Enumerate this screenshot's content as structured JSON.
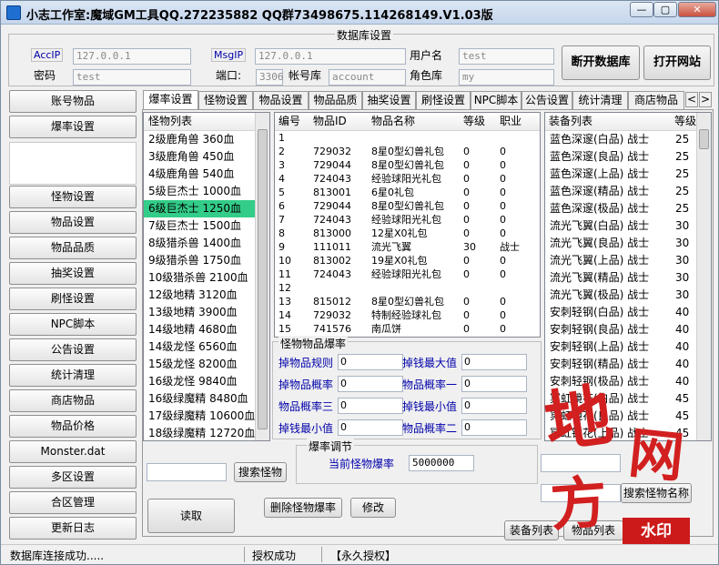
{
  "window": {
    "title": "小志工作室:魔域GM工具QQ.272235882 QQ群73498675.114268149.V1.03版",
    "minimize": "—",
    "maximize": "▢",
    "close": "✕"
  },
  "db": {
    "legend": "数据库设置",
    "acc_ip_label": "AccIP",
    "acc_ip_value": "127.0.0.1",
    "password_label": "密码",
    "password_value": "test",
    "msg_ip_label": "MsgIP",
    "msg_ip_value": "127.0.0.1",
    "port_label": "端口:",
    "port_value": "3306",
    "account_db_label": "帐号库",
    "account_db_value": "account",
    "user_label": "用户名",
    "user_value": "test",
    "role_db_label": "角色库",
    "role_db_value": "my",
    "disconnect_button": "断开数据库",
    "open_site_button": "打开网站"
  },
  "sidebar": {
    "items": [
      "账号物品",
      "爆率设置",
      "怪物设置",
      "物品设置",
      "物品品质",
      "抽奖设置",
      "刷怪设置",
      "NPC脚本",
      "公告设置",
      "统计清理",
      "商店物品",
      "物品价格",
      "Monster.dat",
      "多区设置",
      "合区管理",
      "更新日志"
    ]
  },
  "tabs": [
    "爆率设置",
    "怪物设置",
    "物品设置",
    "物品品质",
    "抽奖设置",
    "刷怪设置",
    "NPC脚本",
    "公告设置",
    "统计清理",
    "商店物品"
  ],
  "tab_nav": {
    "left": "<",
    "right": ">"
  },
  "monster_list": {
    "header": "怪物列表",
    "rows": [
      "2级鹿角兽 360血",
      "3级鹿角兽 450血",
      "4级鹿角兽 540血",
      "5级巨杰士 1000血",
      "6级巨杰士 1250血",
      "7级巨杰士 1500血",
      "8级猎杀兽 1400血",
      "9级猎杀兽 1750血",
      "10级猎杀兽 2100血",
      "12级地精 3120血",
      "13级地精 3900血",
      "14级地精 4680血",
      "14级龙怪 6560血",
      "15级龙怪 8200血",
      "16级龙怪 9840血",
      "16级绿魔精 8480血",
      "17级绿魔精 10600血",
      "18级绿魔精 12720血"
    ],
    "selected_index": 4
  },
  "drop_table": {
    "headers": [
      "编号",
      "物品ID",
      "物品名称",
      "等级",
      "职业"
    ],
    "rows": [
      [
        "1",
        "",
        "",
        "",
        ""
      ],
      [
        "2",
        "729032",
        "8星0型幻兽礼包",
        "0",
        "0"
      ],
      [
        "3",
        "729044",
        "8星0型幻兽礼包",
        "0",
        "0"
      ],
      [
        "4",
        "724043",
        "经验球阳光礼包",
        "0",
        "0"
      ],
      [
        "5",
        "813001",
        "6星0礼包",
        "0",
        "0"
      ],
      [
        "6",
        "729044",
        "8星0型幻兽礼包",
        "0",
        "0"
      ],
      [
        "7",
        "724043",
        "经验球阳光礼包",
        "0",
        "0"
      ],
      [
        "8",
        "813000",
        "12星X0礼包",
        "0",
        "0"
      ],
      [
        "9",
        "111011",
        "流光飞翼",
        "30",
        "战士"
      ],
      [
        "10",
        "813002",
        "19星X0礼包",
        "0",
        "0"
      ],
      [
        "11",
        "724043",
        "经验球阳光礼包",
        "0",
        "0"
      ],
      [
        "12",
        "",
        "",
        "",
        ""
      ],
      [
        "13",
        "815012",
        "8星0型幻兽礼包",
        "0",
        "0"
      ],
      [
        "14",
        "729032",
        "特制经验球礼包",
        "0",
        "0"
      ],
      [
        "15",
        "741576",
        "南瓜饼",
        "0",
        "0"
      ]
    ]
  },
  "monster_drop": {
    "legend": "怪物物品爆率",
    "fields": [
      {
        "label": "掉物品规则",
        "value": "0"
      },
      {
        "label": "掉钱最大值",
        "value": "0"
      },
      {
        "label": "掉物品概率",
        "value": "0"
      },
      {
        "label": "物品概率一",
        "value": "0"
      },
      {
        "label": "物品概率三",
        "value": "0"
      },
      {
        "label": "掉钱最小值",
        "value": "0"
      },
      {
        "label": "掉钱最小值",
        "value": "0"
      },
      {
        "label": "物品概率二",
        "value": "0"
      }
    ]
  },
  "equip_list": {
    "headers": [
      "装备列表",
      "等级"
    ],
    "rows": [
      [
        "蓝色深邃(白品) 战士",
        "25"
      ],
      [
        "蓝色深邃(良品) 战士",
        "25"
      ],
      [
        "蓝色深邃(上品) 战士",
        "25"
      ],
      [
        "蓝色深邃(精品) 战士",
        "25"
      ],
      [
        "蓝色深邃(极品) 战士",
        "25"
      ],
      [
        "流光飞翼(白品) 战士",
        "30"
      ],
      [
        "流光飞翼(良品) 战士",
        "30"
      ],
      [
        "流光飞翼(上品) 战士",
        "30"
      ],
      [
        "流光飞翼(精品) 战士",
        "30"
      ],
      [
        "流光飞翼(极品) 战士",
        "30"
      ],
      [
        "安刺轻钢(白品) 战士",
        "40"
      ],
      [
        "安刺轻钢(良品) 战士",
        "40"
      ],
      [
        "安刺轻钢(上品) 战士",
        "40"
      ],
      [
        "安刺轻钢(精品) 战士",
        "40"
      ],
      [
        "安刺轻钢(极品) 战士",
        "40"
      ],
      [
        "冥虹镜花(白品) 战士",
        "45"
      ],
      [
        "冥虹镜花(良品) 战士",
        "45"
      ],
      [
        "冥虹镜花(上品) 战士",
        "45"
      ]
    ]
  },
  "rate_adjust": {
    "legend": "爆率调节",
    "current_label": "当前怪物爆率",
    "current_value": "5000000"
  },
  "buttons": {
    "search_monster": "搜索怪物",
    "read": "读取",
    "delete_monster_rate": "删除怪物爆率",
    "modify": "修改",
    "equip_list": "装备列表",
    "item_list": "物品列表",
    "search_monster_name": "搜索怪物名称"
  },
  "status": {
    "connection": "数据库连接成功.....",
    "auth": "授权成功",
    "license": "【永久授权】"
  },
  "watermark": {
    "chars": [
      "地",
      "网",
      "方"
    ],
    "stamp": "水印"
  }
}
